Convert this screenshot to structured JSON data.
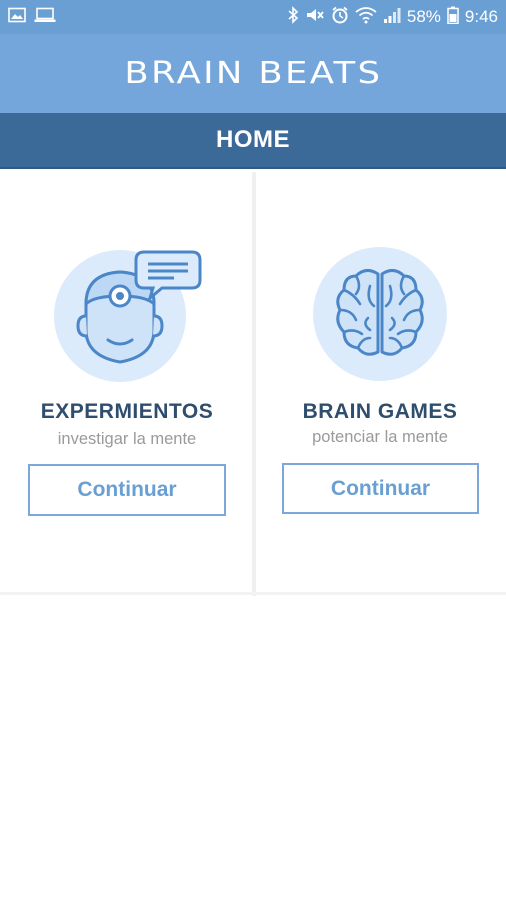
{
  "status_bar": {
    "battery_percent": "58%",
    "time": "9:46",
    "icons": [
      "image-icon",
      "laptop-icon",
      "bluetooth-icon",
      "mute-icon",
      "alarm-icon",
      "wifi-icon",
      "signal-icon",
      "battery-icon"
    ]
  },
  "app": {
    "title": "BRAIN BEATS"
  },
  "tab": {
    "title": "HOME"
  },
  "cards": [
    {
      "title": "EXPERMIENTOS",
      "subtitle": "investigar la mente",
      "button_label": "Continuar",
      "icon": "doctor-chat-icon"
    },
    {
      "title": "BRAIN GAMES",
      "subtitle": "potenciar la mente",
      "button_label": "Continuar",
      "icon": "brain-icon"
    }
  ],
  "colors": {
    "status_bar": "#6a9fd3",
    "app_bar": "#75a6db",
    "tab_bar": "#3b6a99",
    "title_text": "#2f4e6d",
    "accent": "#7ca7d8",
    "illustration_bg": "#dcebfb"
  }
}
